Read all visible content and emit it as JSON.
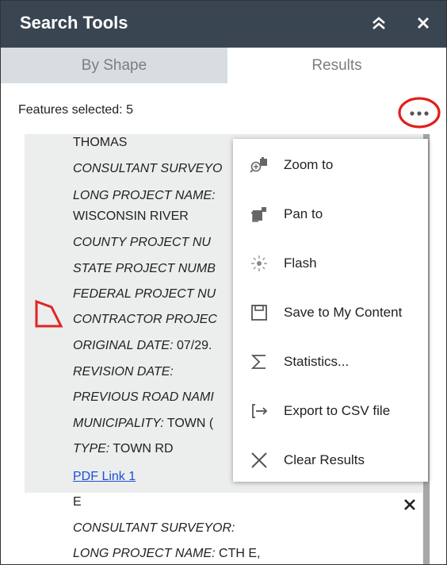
{
  "panel": {
    "title": "Search Tools",
    "tabs": [
      {
        "label": "By Shape"
      },
      {
        "label": "Results"
      }
    ],
    "features_selected": "Features selected: 5"
  },
  "result1": {
    "lines": [
      {
        "key": "",
        "value": "THOMAS"
      },
      {
        "key": "CONSULTANT SURVEYO",
        "value": ""
      },
      {
        "key": "LONG PROJECT NAME:",
        "value": ""
      },
      {
        "key": "",
        "value": "WISCONSIN RIVER"
      },
      {
        "key": "COUNTY PROJECT NU",
        "value": ""
      },
      {
        "key": "STATE PROJECT NUMB",
        "value": ""
      },
      {
        "key": "FEDERAL PROJECT NU",
        "value": ""
      },
      {
        "key": "CONTRACTOR PROJEC",
        "value": ""
      },
      {
        "key": "ORIGINAL DATE:",
        "value": " 07/29."
      },
      {
        "key": "REVISION DATE:",
        "value": ""
      },
      {
        "key": "PREVIOUS ROAD NAMI",
        "value": ""
      },
      {
        "key": "MUNICIPALITY:",
        "value": " TOWN ("
      },
      {
        "key": "TYPE:",
        "value": " TOWN RD"
      }
    ],
    "link": "PDF Link 1"
  },
  "result2": {
    "lines": [
      {
        "key": "",
        "value": "E"
      },
      {
        "key": "CONSULTANT SURVEYOR:",
        "value": ""
      },
      {
        "key": "LONG PROJECT NAME:",
        "value": " CTH E,"
      }
    ]
  },
  "menu": {
    "items": [
      {
        "label": "Zoom to",
        "icon": "zoom-to-icon"
      },
      {
        "label": "Pan to",
        "icon": "pan-to-icon"
      },
      {
        "label": "Flash",
        "icon": "flash-icon"
      },
      {
        "label": "Save to My Content",
        "icon": "save-icon"
      },
      {
        "label": "Statistics...",
        "icon": "statistics-icon"
      },
      {
        "label": "Export to CSV file",
        "icon": "export-icon"
      },
      {
        "label": "Clear Results",
        "icon": "clear-icon"
      }
    ]
  },
  "colors": {
    "titlebar": "#3a4552",
    "highlight_circle": "#e0201c",
    "polygon": "#e02424",
    "link": "#1a4fd8"
  }
}
